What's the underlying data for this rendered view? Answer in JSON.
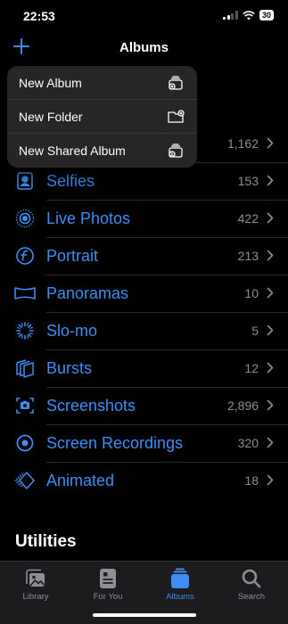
{
  "status_bar": {
    "time": "22:53",
    "battery": "30"
  },
  "nav": {
    "title": "Albums"
  },
  "menu": {
    "items": [
      {
        "label": "New Album",
        "icon": "new-album-icon"
      },
      {
        "label": "New Folder",
        "icon": "new-folder-icon"
      },
      {
        "label": "New Shared Album",
        "icon": "new-shared-album-icon"
      }
    ]
  },
  "media_types": {
    "items": [
      {
        "label": "",
        "count": "1,162"
      },
      {
        "label": "Selfies",
        "count": "153",
        "icon": "selfie-icon"
      },
      {
        "label": "Live Photos",
        "count": "422",
        "icon": "live-photo-icon"
      },
      {
        "label": "Portrait",
        "count": "213",
        "icon": "portrait-icon"
      },
      {
        "label": "Panoramas",
        "count": "10",
        "icon": "panorama-icon"
      },
      {
        "label": "Slo-mo",
        "count": "5",
        "icon": "slo-mo-icon"
      },
      {
        "label": "Bursts",
        "count": "12",
        "icon": "bursts-icon"
      },
      {
        "label": "Screenshots",
        "count": "2,896",
        "icon": "screenshot-icon"
      },
      {
        "label": "Screen Recordings",
        "count": "320",
        "icon": "screen-recording-icon"
      },
      {
        "label": "Animated",
        "count": "18",
        "icon": "animated-icon"
      }
    ]
  },
  "utilities": {
    "title": "Utilities"
  },
  "tabbar": {
    "tabs": [
      {
        "label": "Library",
        "icon": "library-icon"
      },
      {
        "label": "For You",
        "icon": "for-you-icon"
      },
      {
        "label": "Albums",
        "icon": "albums-icon",
        "active": true
      },
      {
        "label": "Search",
        "icon": "search-icon"
      }
    ]
  },
  "colors": {
    "accent": "#3d8ef0",
    "secondary": "#8e8e93",
    "menu_bg": "#262628"
  }
}
